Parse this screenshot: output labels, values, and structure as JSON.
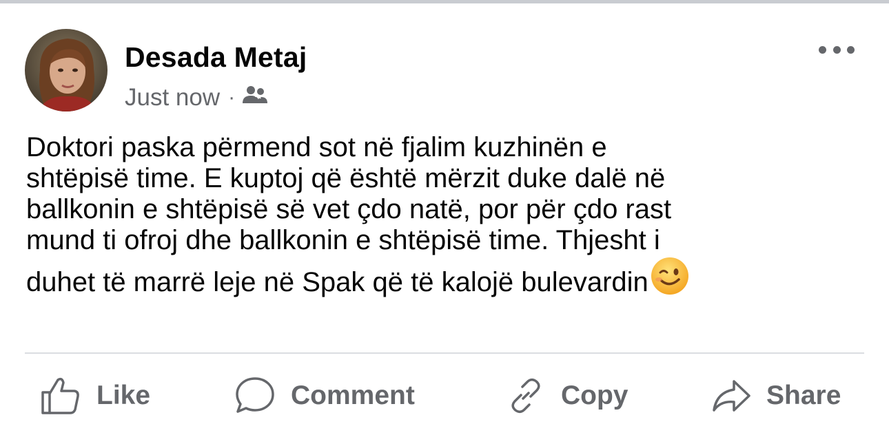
{
  "post": {
    "author": "Desada Metaj",
    "timestamp": "Just now",
    "separator": "·",
    "audience_icon": "friends-icon",
    "text": "Doktori paska përmend sot në fjalim kuzhinën e\nshtëpisë time. E kuptoj që është mërzit duke dalë në\nballkonin e shtëpisë së vet çdo natë, por për çdo rast\nmund ti ofroj dhe ballkonin e shtëpisë time. Thjesht i\nduhet të marrë leje në Spak që të kalojë bulevardin",
    "trailing_emoji": "winking-face-emoji"
  },
  "actions": {
    "like": "Like",
    "comment": "Comment",
    "copy": "Copy",
    "share": "Share"
  },
  "colors": {
    "secondary_text": "#65676b",
    "primary_text": "#050505",
    "divider": "#dadde1"
  }
}
